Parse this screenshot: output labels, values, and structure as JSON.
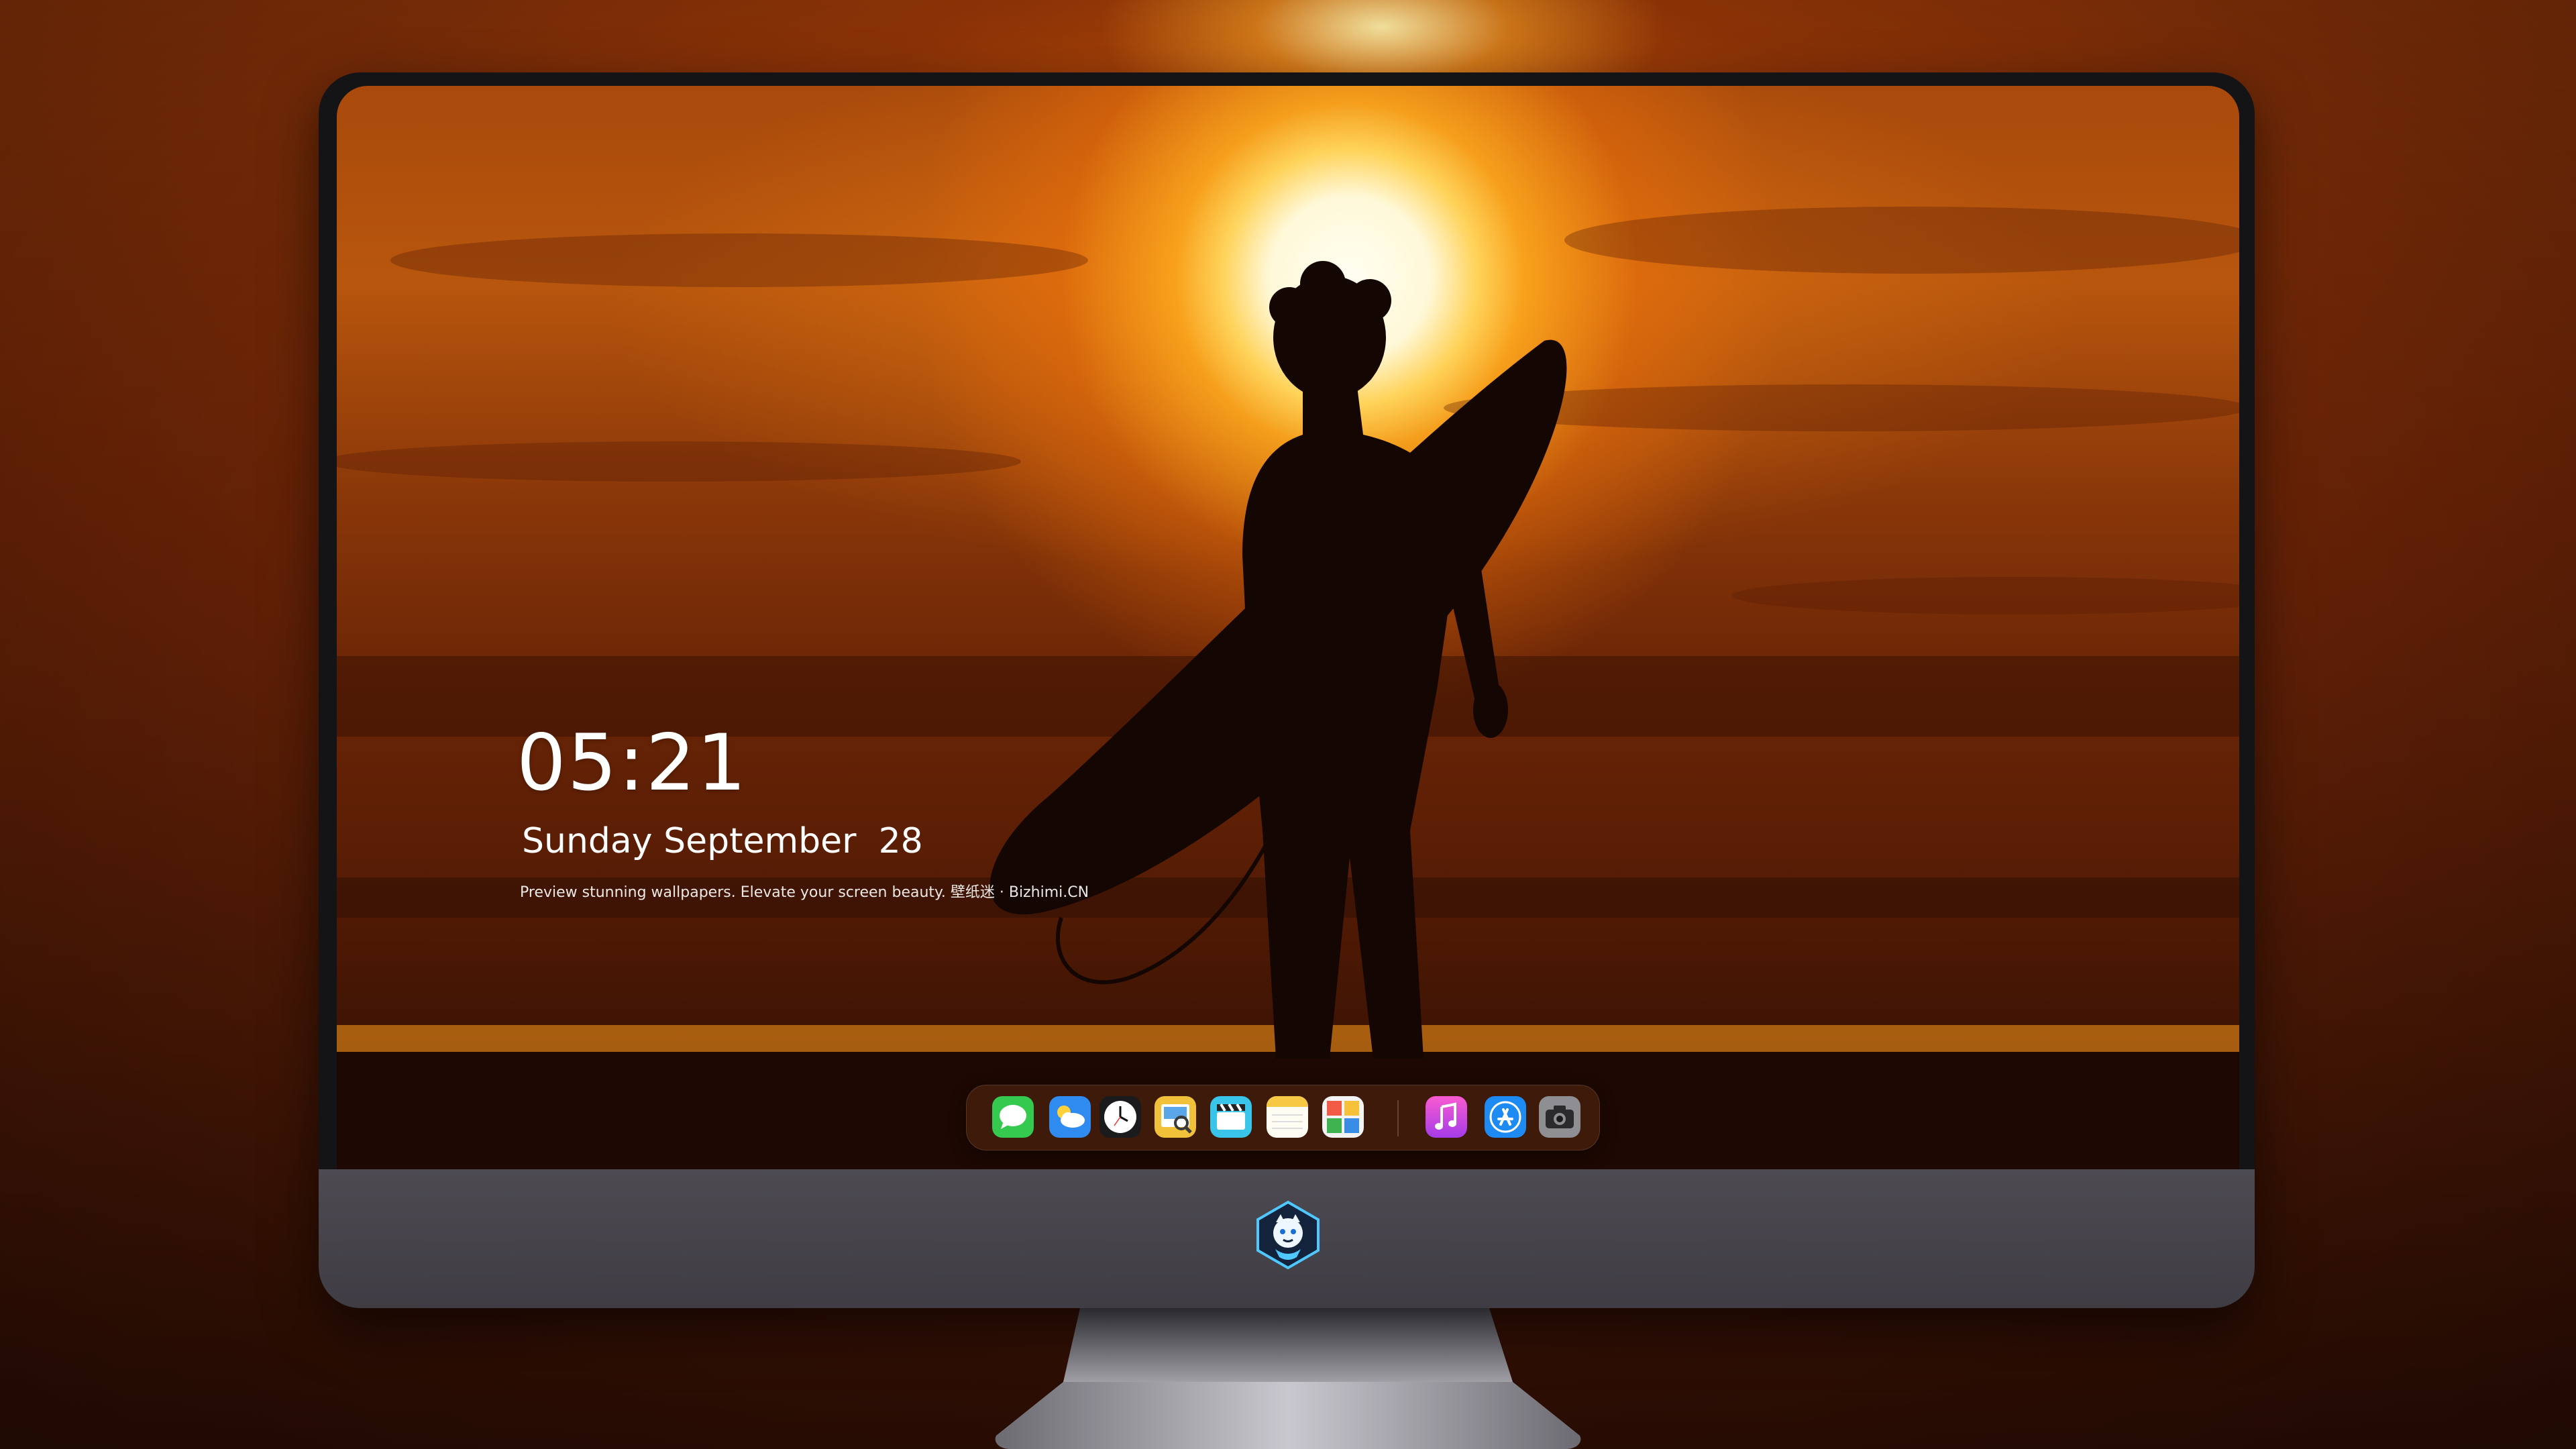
{
  "lockscreen": {
    "time": "05:21",
    "date": "Sunday September  28",
    "caption": "Preview stunning wallpapers. Elevate your screen beauty. 壁纸迷 · Bizhimi.CN"
  },
  "wallpaper": {
    "subject": "surfer silhouette at sunset"
  },
  "dock": {
    "apps": [
      {
        "name": "Messages",
        "icon": "messages-icon"
      },
      {
        "name": "Weather",
        "icon": "weather-icon"
      },
      {
        "name": "Clock",
        "icon": "clock-icon"
      },
      {
        "name": "Preview",
        "icon": "preview-icon"
      },
      {
        "name": "Clips",
        "icon": "clapperboard-icon"
      },
      {
        "name": "Notes",
        "icon": "notes-icon"
      },
      {
        "name": "Photo Booth",
        "icon": "photo-booth-icon"
      },
      {
        "name": "iTunes",
        "icon": "music-note-icon"
      },
      {
        "name": "App Store",
        "icon": "app-store-icon"
      },
      {
        "name": "Camera",
        "icon": "camera-icon"
      }
    ]
  },
  "colors": {
    "sun": "#fff8d8",
    "sky": "#b8560d",
    "silhouette": "#140703",
    "bezel": "#141416",
    "chin": "#46434b"
  }
}
